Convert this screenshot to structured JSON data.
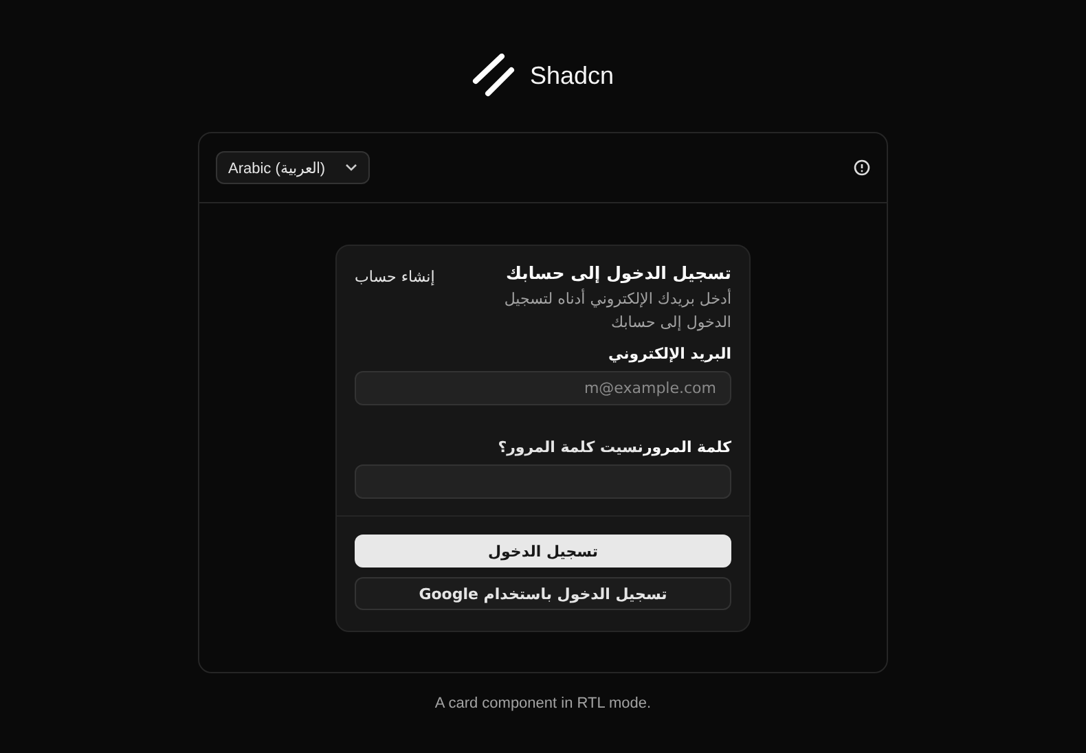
{
  "brand": {
    "name": "Shadcn"
  },
  "toolbar": {
    "language_select": "Arabic (العربية)"
  },
  "card": {
    "title": "تسجيل الدخول إلى حسابك",
    "description": "أدخل بريدك الإلكتروني أدناه لتسجيل الدخول إلى حسابك",
    "action_link": "إنشاء حساب",
    "email": {
      "label": "البريد الإلكتروني",
      "placeholder": "m@example.com"
    },
    "password": {
      "label": "كلمة المرور",
      "link": "نسيت كلمة المرور؟"
    },
    "buttons": [
      {
        "label": "تسجيل الدخول",
        "kind": "primary"
      },
      {
        "label": "تسجيل الدخول باستخدام Google",
        "kind": "outline"
      }
    ]
  },
  "caption": "A card component in RTL mode."
}
